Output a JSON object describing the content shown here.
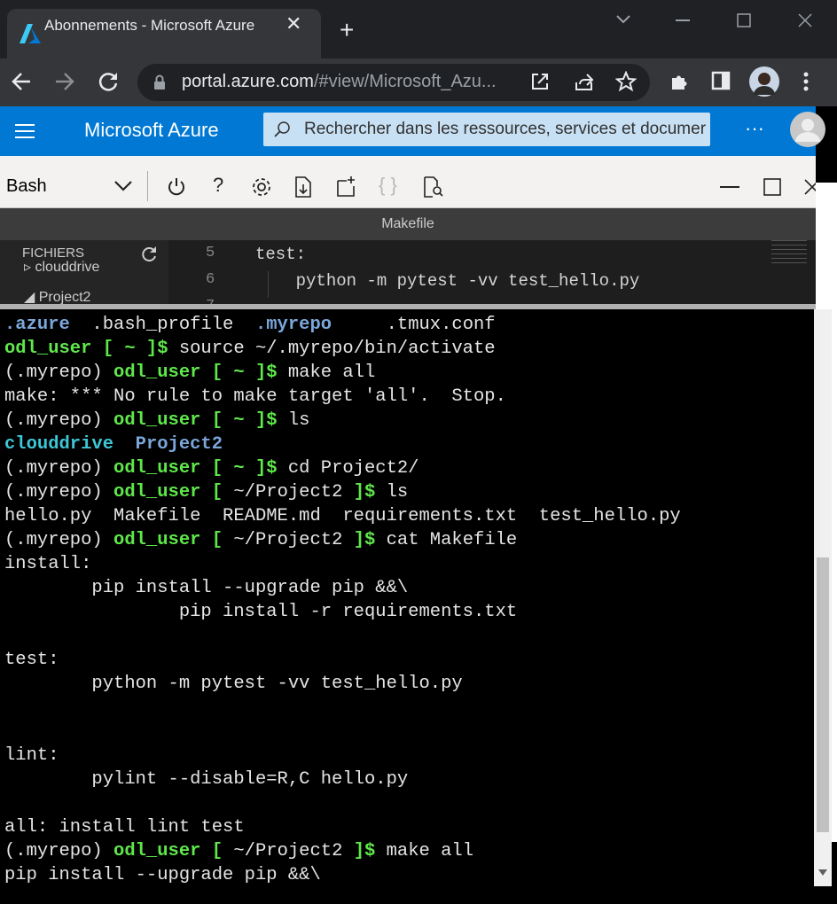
{
  "browser": {
    "tab_title": "Abonnements - Microsoft Azure",
    "tab_close": "✕",
    "new_tab": "+",
    "url_host": "portal.azure.com",
    "url_rest": "/#view/Microsoft_Azu..."
  },
  "azure": {
    "brand": "Microsoft Azure",
    "search_placeholder": "Rechercher dans les ressources, services et documer",
    "more": "···"
  },
  "shell": {
    "type": "Bash",
    "editor_title": "Makefile",
    "files_header": "FICHIERS",
    "tree": [
      "clouddrive",
      "Project2"
    ],
    "code_lines": [
      {
        "num": "5",
        "text": "test:"
      },
      {
        "num": "6",
        "text": "    python -m pytest -vv test_hello.py"
      },
      {
        "num": "7",
        "text": ""
      }
    ]
  },
  "terminal": {
    "lines": [
      [
        {
          "t": ".azure",
          "s": "b"
        },
        {
          "t": "  .bash_profile  "
        },
        {
          "t": ".myrepo",
          "s": "b"
        },
        {
          "t": "     .tmux.conf"
        }
      ],
      [
        {
          "t": "odl_user [ ~ ]$",
          "s": "g"
        },
        {
          "t": " source ~/.myrepo/bin/activate"
        }
      ],
      [
        {
          "t": "(.myrepo) "
        },
        {
          "t": "odl_user [ ~ ]$",
          "s": "g"
        },
        {
          "t": " make all"
        }
      ],
      [
        {
          "t": "make: *** No rule to make target 'all'.  Stop."
        }
      ],
      [
        {
          "t": "(.myrepo) "
        },
        {
          "t": "odl_user [ ~ ]$",
          "s": "g"
        },
        {
          "t": " ls"
        }
      ],
      [
        {
          "t": "clouddrive",
          "s": "c"
        },
        {
          "t": "  "
        },
        {
          "t": "Project2",
          "s": "b"
        }
      ],
      [
        {
          "t": "(.myrepo) "
        },
        {
          "t": "odl_user [ ~ ]$",
          "s": "g"
        },
        {
          "t": " cd Project2/"
        }
      ],
      [
        {
          "t": "(.myrepo) "
        },
        {
          "t": "odl_user [ ",
          "s": "g"
        },
        {
          "t": "~/Project2"
        },
        {
          "t": " ]$",
          "s": "g"
        },
        {
          "t": " ls"
        }
      ],
      [
        {
          "t": "hello.py  Makefile  README.md  requirements.txt  test_hello.py"
        }
      ],
      [
        {
          "t": "(.myrepo) "
        },
        {
          "t": "odl_user [ ",
          "s": "g"
        },
        {
          "t": "~/Project2"
        },
        {
          "t": " ]$",
          "s": "g"
        },
        {
          "t": " cat Makefile"
        }
      ],
      [
        {
          "t": "install:"
        }
      ],
      [
        {
          "t": "        pip install --upgrade pip &&\\"
        }
      ],
      [
        {
          "t": "                pip install -r requirements.txt"
        }
      ],
      [
        {
          "t": ""
        }
      ],
      [
        {
          "t": "test:"
        }
      ],
      [
        {
          "t": "        python -m pytest -vv test_hello.py"
        }
      ],
      [
        {
          "t": ""
        }
      ],
      [
        {
          "t": ""
        }
      ],
      [
        {
          "t": "lint:"
        }
      ],
      [
        {
          "t": "        pylint --disable=R,C hello.py"
        }
      ],
      [
        {
          "t": ""
        }
      ],
      [
        {
          "t": "all: install lint test"
        }
      ],
      [
        {
          "t": "(.myrepo) "
        },
        {
          "t": "odl_user [ ",
          "s": "g"
        },
        {
          "t": "~/Project2"
        },
        {
          "t": " ]$",
          "s": "g"
        },
        {
          "t": " make all"
        }
      ],
      [
        {
          "t": "pip install --upgrade pip &&\\"
        }
      ]
    ]
  }
}
